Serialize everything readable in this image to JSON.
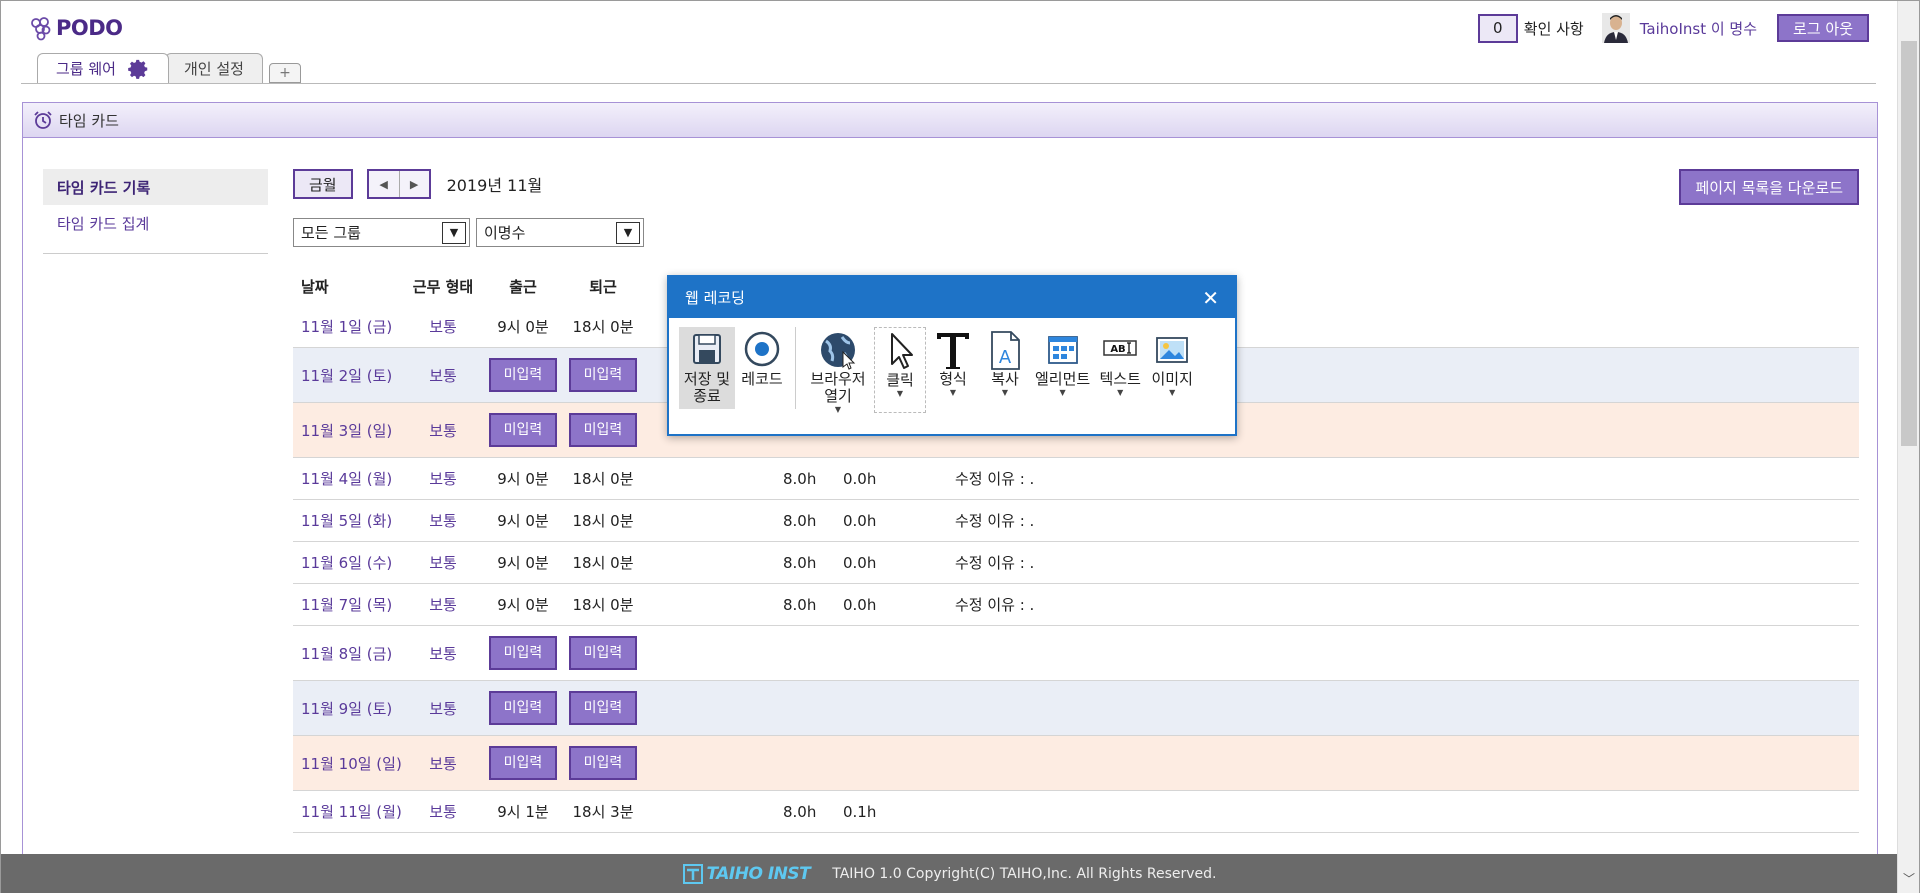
{
  "header": {
    "logo_text": "PODO",
    "notice_count": "0",
    "notice_label": "확인 사항",
    "user_name": "TaihoInst 이 명수",
    "logout_label": "로그 아웃"
  },
  "tabs": [
    {
      "label": "그룹 웨어"
    },
    {
      "label": "개인 설정"
    }
  ],
  "panel": {
    "title": "타임 카드"
  },
  "sidebar": {
    "items": [
      {
        "label": "타임 카드 기록"
      },
      {
        "label": "타임 카드 집계"
      }
    ]
  },
  "toolbar": {
    "this_month_label": "금월",
    "month": "2019년 11월",
    "download_label": "페이지 목록을 다운로드",
    "group_select": "모든 그룹",
    "user_select": "이명수"
  },
  "table": {
    "headers": [
      "날짜",
      "근무 형태",
      "출근",
      "퇴근"
    ],
    "pending_label": "미입력",
    "rows": [
      {
        "date": "11월 1일 (금)",
        "type": "보통",
        "in": "9시 0분",
        "out": "18시 0분",
        "h1": "",
        "h2": "",
        "note": ""
      },
      {
        "date": "11월 2일 (토)",
        "type": "보통",
        "pending": true
      },
      {
        "date": "11월 3일 (일)",
        "type": "보통",
        "pending": true
      },
      {
        "date": "11월 4일 (월)",
        "type": "보통",
        "in": "9시 0분",
        "out": "18시 0분",
        "h1": "8.0h",
        "h2": "0.0h",
        "note": "수정 이유 : ."
      },
      {
        "date": "11월 5일 (화)",
        "type": "보통",
        "in": "9시 0분",
        "out": "18시 0분",
        "h1": "8.0h",
        "h2": "0.0h",
        "note": "수정 이유 : ."
      },
      {
        "date": "11월 6일 (수)",
        "type": "보통",
        "in": "9시 0분",
        "out": "18시 0분",
        "h1": "8.0h",
        "h2": "0.0h",
        "note": "수정 이유 : ."
      },
      {
        "date": "11월 7일 (목)",
        "type": "보통",
        "in": "9시 0분",
        "out": "18시 0분",
        "h1": "8.0h",
        "h2": "0.0h",
        "note": "수정 이유 : ."
      },
      {
        "date": "11월 8일 (금)",
        "type": "보통",
        "pending": true
      },
      {
        "date": "11월 9일 (토)",
        "type": "보통",
        "pending": true
      },
      {
        "date": "11월 10일 (일)",
        "type": "보통",
        "pending": true
      },
      {
        "date": "11월 11일 (월)",
        "type": "보통",
        "in": "9시 1분",
        "out": "18시 3분",
        "h1": "8.0h",
        "h2": "0.1h",
        "note": ""
      }
    ]
  },
  "footer": {
    "logo_text": "TAIHO INST",
    "copyright": "TAIHO 1.0 Copyright(C) TAIHO,Inc. All Rights Reserved."
  },
  "recorder": {
    "title": "웹 레코딩",
    "tools": [
      {
        "label": "저장 및 종료"
      },
      {
        "label": "레코드"
      },
      {
        "label": "브라우저 열기"
      },
      {
        "label": "클릭"
      },
      {
        "label": "형식"
      },
      {
        "label": "복사"
      },
      {
        "label": "엘리먼트"
      },
      {
        "label": "텍스트"
      },
      {
        "label": "이미지"
      }
    ]
  }
}
